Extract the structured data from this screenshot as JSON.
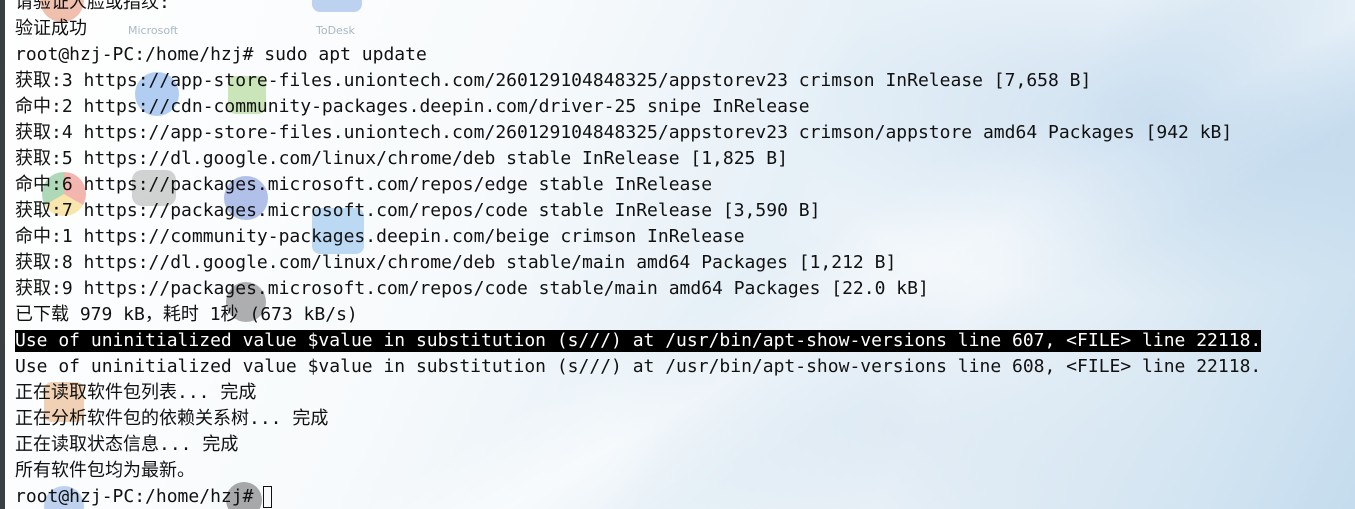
{
  "terminal": {
    "lines": [
      "请验证人脸或指纹:",
      "验证成功",
      "root@hzj-PC:/home/hzj# sudo apt update",
      "获取:3 https://app-store-files.uniontech.com/260129104848325/appstorev23 crimson InRelease [7,658 B]",
      "命中:2 https://cdn-community-packages.deepin.com/driver-25 snipe InRelease",
      "获取:4 https://app-store-files.uniontech.com/260129104848325/appstorev23 crimson/appstore amd64 Packages [942 kB]",
      "获取:5 https://dl.google.com/linux/chrome/deb stable InRelease [1,825 B]",
      "命中:6 https://packages.microsoft.com/repos/edge stable InRelease",
      "获取:7 https://packages.microsoft.com/repos/code stable InRelease [3,590 B]",
      "命中:1 https://community-packages.deepin.com/beige crimson InRelease",
      "获取:8 https://dl.google.com/linux/chrome/deb stable/main amd64 Packages [1,212 B]",
      "获取:9 https://packages.microsoft.com/repos/code stable/main amd64 Packages [22.0 kB]",
      "已下载 979 kB，耗时 1秒 (673 kB/s)",
      "Use of uninitialized value $value in substitution (s///) at /usr/bin/apt-show-versions line 607, <FILE> line 22118.",
      "Use of uninitialized value $value in substitution (s///) at /usr/bin/apt-show-versions line 608, <FILE> line 22118.",
      "正在读取软件包列表... 完成",
      "正在分析软件包的依赖关系树... 完成",
      "正在读取状态信息... 完成",
      "所有软件包均为最新。"
    ],
    "prompt": "root@hzj-PC:/home/hzj#"
  },
  "desktop": {
    "labels": [
      "Microsoft",
      "ToDesk"
    ]
  },
  "colors": {
    "text": "#111111",
    "highlight_bg": "#000000",
    "highlight_fg": "#ffffff"
  }
}
